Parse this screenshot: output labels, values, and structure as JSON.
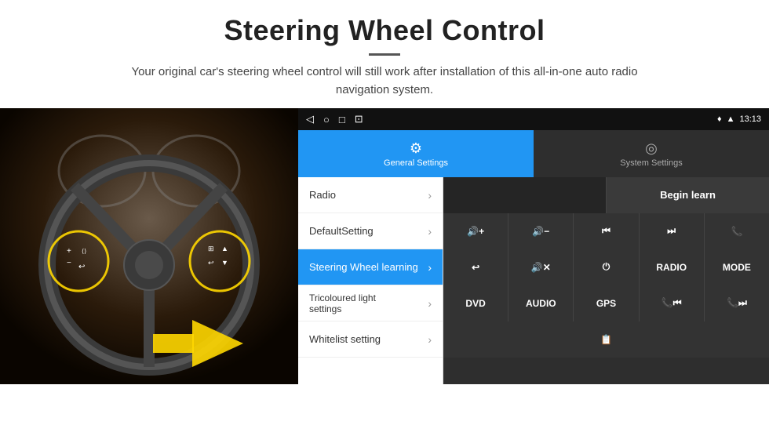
{
  "header": {
    "title": "Steering Wheel Control",
    "divider": true,
    "subtitle": "Your original car's steering wheel control will still work after installation of this all-in-one auto radio navigation system."
  },
  "status_bar": {
    "nav_back": "◁",
    "nav_home": "○",
    "nav_recent": "□",
    "nav_extra": "⊡",
    "signal": "▲",
    "wifi": "▲",
    "time": "13:13"
  },
  "tabs": [
    {
      "id": "general",
      "label": "General Settings",
      "icon": "⚙",
      "active": true
    },
    {
      "id": "system",
      "label": "System Settings",
      "icon": "◎",
      "active": false
    }
  ],
  "menu_items": [
    {
      "id": "radio",
      "label": "Radio",
      "active": false
    },
    {
      "id": "default",
      "label": "DefaultSetting",
      "active": false
    },
    {
      "id": "steering",
      "label": "Steering Wheel learning",
      "active": true
    },
    {
      "id": "tricoloured",
      "label": "Tricoloured light settings",
      "active": false
    },
    {
      "id": "whitelist",
      "label": "Whitelist setting",
      "active": false
    }
  ],
  "control_panel": {
    "begin_learn_label": "Begin learn",
    "rows": [
      [
        {
          "id": "empty1",
          "label": "",
          "type": "empty"
        },
        {
          "id": "begin-learn",
          "label": "Begin learn",
          "type": "begin-learn"
        }
      ],
      [
        {
          "id": "vol-up",
          "label": "🔊+",
          "type": "normal"
        },
        {
          "id": "vol-down",
          "label": "🔊−",
          "type": "normal"
        },
        {
          "id": "prev",
          "label": "⏮",
          "type": "normal"
        },
        {
          "id": "next",
          "label": "⏭",
          "type": "normal"
        },
        {
          "id": "phone",
          "label": "📞",
          "type": "normal"
        }
      ],
      [
        {
          "id": "hangup",
          "label": "📞↩",
          "type": "normal"
        },
        {
          "id": "mute",
          "label": "🔊×",
          "type": "normal"
        },
        {
          "id": "power",
          "label": "⏻",
          "type": "normal"
        },
        {
          "id": "radio-btn",
          "label": "RADIO",
          "type": "normal"
        },
        {
          "id": "mode",
          "label": "MODE",
          "type": "normal"
        }
      ],
      [
        {
          "id": "dvd",
          "label": "DVD",
          "type": "normal"
        },
        {
          "id": "audio",
          "label": "AUDIO",
          "type": "normal"
        },
        {
          "id": "gps",
          "label": "GPS",
          "type": "normal"
        },
        {
          "id": "tel-prev",
          "label": "📞⏮",
          "type": "normal"
        },
        {
          "id": "tel-next",
          "label": "📞⏭",
          "type": "normal"
        }
      ],
      [
        {
          "id": "extra",
          "label": "📋",
          "type": "normal"
        }
      ]
    ]
  }
}
